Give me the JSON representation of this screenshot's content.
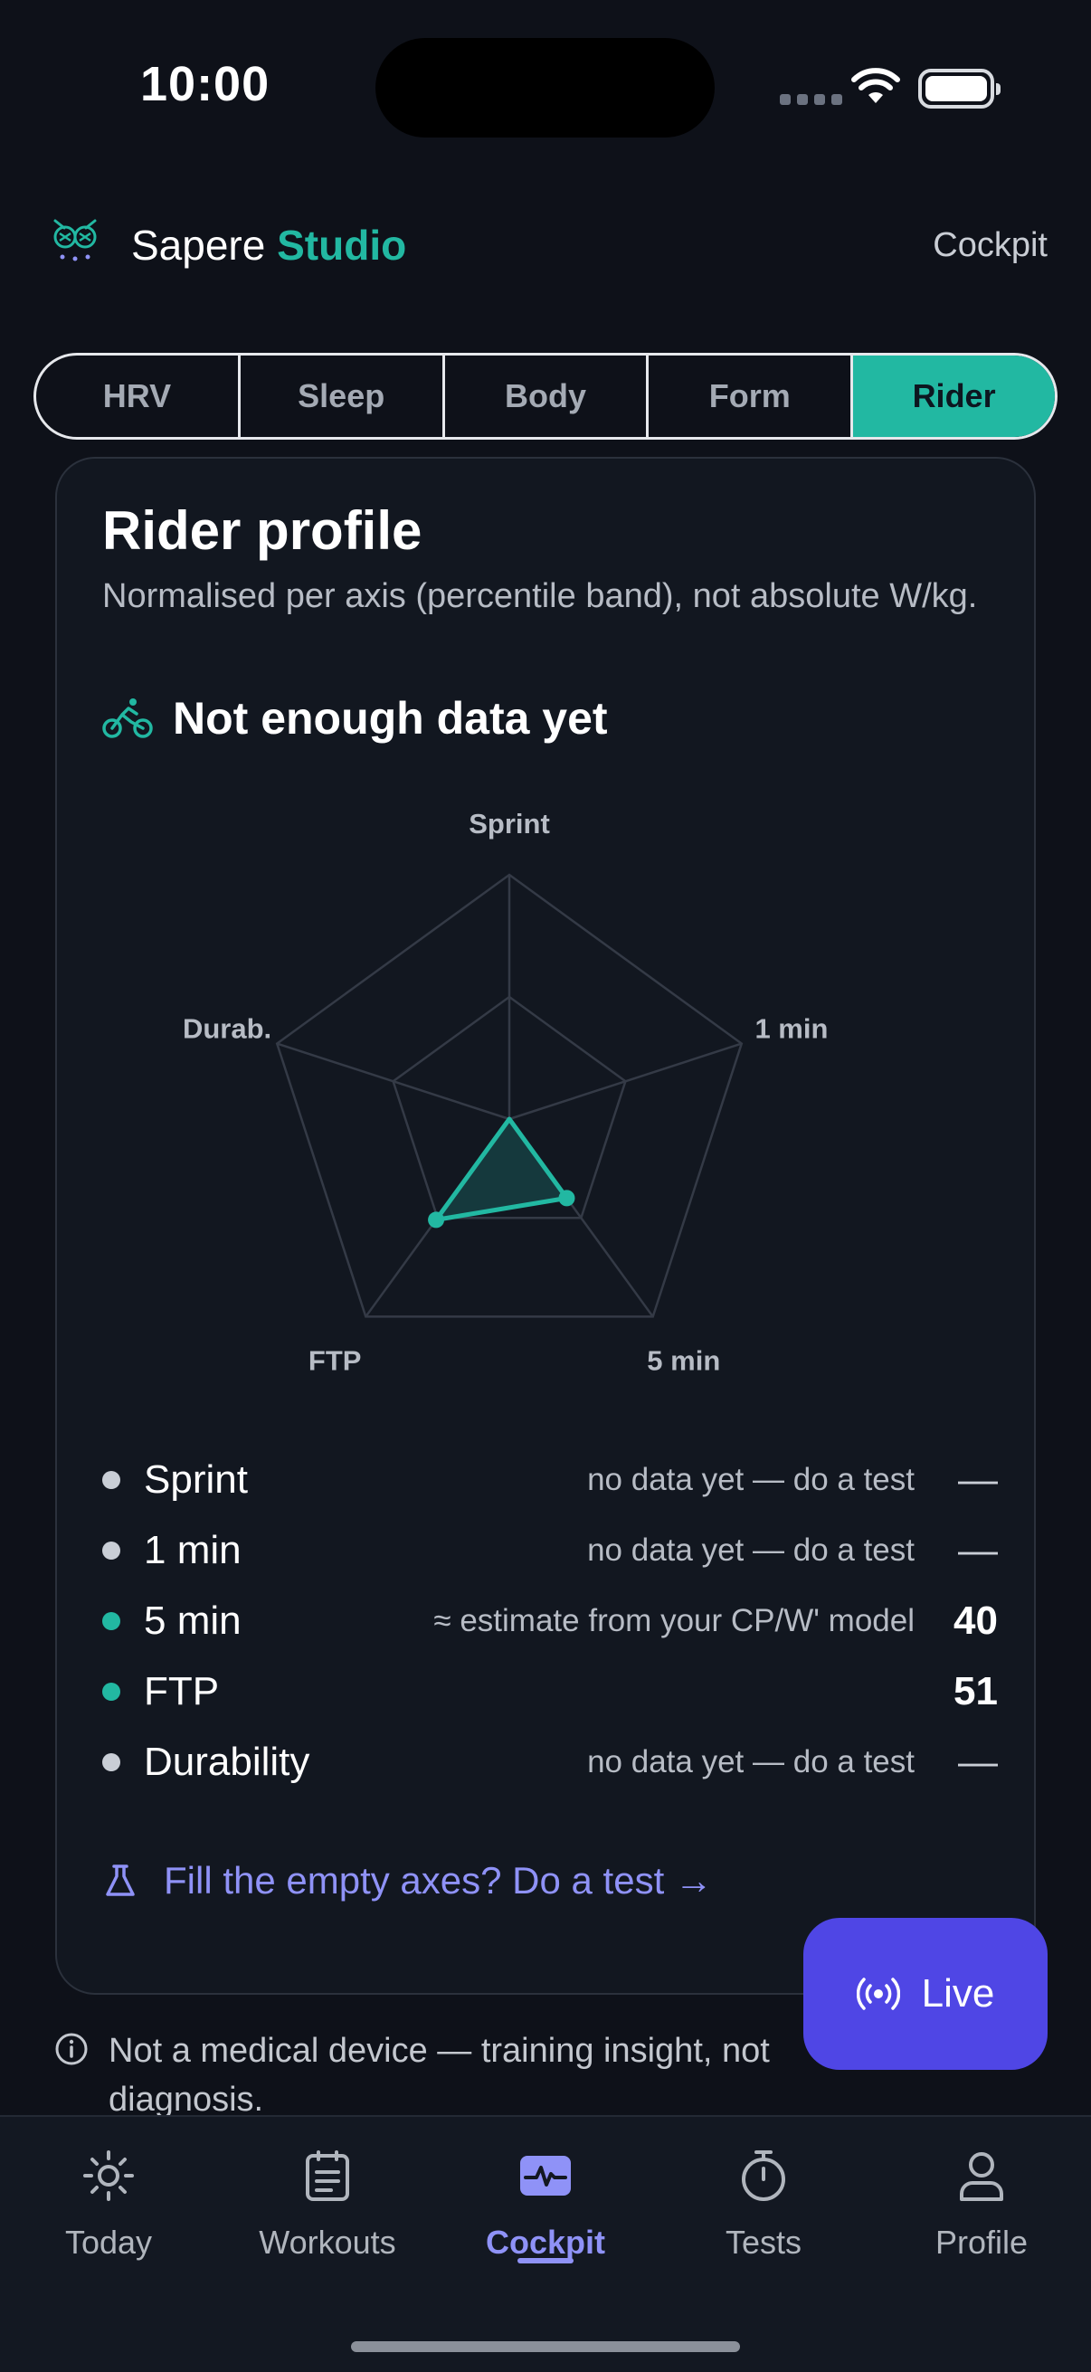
{
  "status_bar": {
    "time": "10:00"
  },
  "header": {
    "brand_primary": "Sapere",
    "brand_accent": "Studio",
    "page_label": "Cockpit"
  },
  "tabs": [
    {
      "label": "HRV",
      "active": false
    },
    {
      "label": "Sleep",
      "active": false
    },
    {
      "label": "Body",
      "active": false
    },
    {
      "label": "Form",
      "active": false
    },
    {
      "label": "Rider",
      "active": true
    }
  ],
  "card": {
    "title": "Rider profile",
    "subtitle": "Normalised per axis (percentile band), not absolute W/kg.",
    "state_text": "Not enough data yet"
  },
  "chart_data": {
    "type": "radar",
    "axes": [
      "Sprint",
      "1 min",
      "5 min",
      "FTP",
      "Durab."
    ],
    "series": [
      {
        "values": [
          null,
          null,
          40,
          51,
          null
        ]
      }
    ],
    "range": [
      0,
      100
    ],
    "grid_levels": 2
  },
  "metrics": [
    {
      "name": "Sprint",
      "note": "no data yet — do a test",
      "value": "—",
      "status": "grey"
    },
    {
      "name": "1 min",
      "note": "no data yet — do a test",
      "value": "—",
      "status": "grey"
    },
    {
      "name": "5 min",
      "note": "≈ estimate from your CP/W' model",
      "value": "40",
      "status": "teal"
    },
    {
      "name": "FTP",
      "note": "",
      "value": "51",
      "status": "teal"
    },
    {
      "name": "Durability",
      "note": "no data yet — do a test",
      "value": "—",
      "status": "grey"
    }
  ],
  "cta": {
    "label": "Fill the empty axes? Do a test →"
  },
  "live_button": {
    "label": "Live"
  },
  "disclaimer": {
    "text": "Not a medical device — training insight, not diagnosis."
  },
  "bottom_nav": [
    {
      "label": "Today",
      "icon": "sun-icon"
    },
    {
      "label": "Workouts",
      "icon": "clipboard-icon"
    },
    {
      "label": "Cockpit",
      "icon": "pulse-icon",
      "active": true
    },
    {
      "label": "Tests",
      "icon": "stopwatch-icon"
    },
    {
      "label": "Profile",
      "icon": "person-icon"
    }
  ],
  "colors": {
    "accent": "#22b8a2",
    "primary": "#4f46e5",
    "link": "#8f92f7",
    "background": "#0e1119"
  }
}
